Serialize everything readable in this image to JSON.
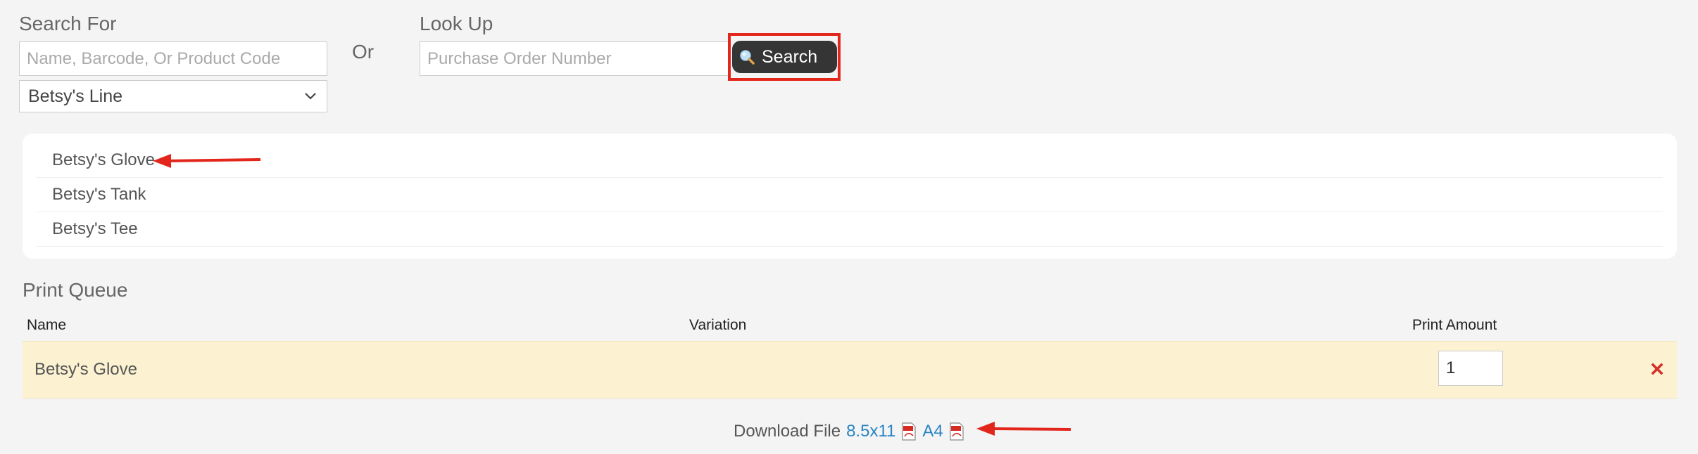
{
  "search_for": {
    "label": "Search For",
    "placeholder": "Name, Barcode, Or Product Code",
    "line_selected": "Betsy's Line"
  },
  "or_label": "Or",
  "lookup": {
    "label": "Look Up",
    "placeholder": "Purchase Order Number"
  },
  "search_button": {
    "label": "Search"
  },
  "results": [
    {
      "label": "Betsy's Glove"
    },
    {
      "label": "Betsy's Tank"
    },
    {
      "label": "Betsy's Tee"
    }
  ],
  "print_queue": {
    "title": "Print Queue",
    "headers": {
      "name": "Name",
      "variation": "Variation",
      "print_amount": "Print Amount"
    },
    "rows": [
      {
        "name": "Betsy's Glove",
        "variation": "",
        "print_amount": "1"
      }
    ]
  },
  "download": {
    "label": "Download File",
    "letter_label": "8.5x11",
    "a4_label": "A4"
  },
  "colors": {
    "annotation_red": "#e3261b",
    "link_blue": "#2a84c4",
    "queue_row_bg": "#fcf2d2",
    "button_dark": "#353535"
  }
}
